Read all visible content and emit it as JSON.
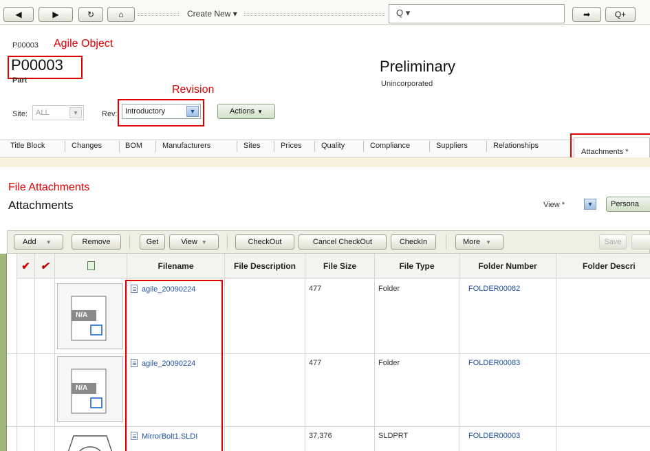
{
  "nav": {
    "create_new_label": "Create New",
    "create_new_caret": "▾",
    "search_glyph": "Q ▾",
    "add_search_glyph": "Q+"
  },
  "object": {
    "number_small": "P00003",
    "annotation_agile_object": "Agile Object",
    "number_big": "P00003",
    "type": "Part",
    "status": "Preliminary",
    "status_sub": "Unincorporated",
    "annotation_revision": "Revision"
  },
  "site": {
    "label": "Site:",
    "value": "ALL"
  },
  "rev": {
    "label": "Rev:",
    "value": "Introductory"
  },
  "actions_label": "Actions",
  "tabs": [
    "Title Block",
    "Changes",
    "BOM",
    "Manufacturers",
    "Sites",
    "Prices",
    "Quality",
    "Compliance",
    "Suppliers",
    "Relationships"
  ],
  "tab_active": "Attachments *",
  "section": {
    "annotation": "File Attachments",
    "title": "Attachments",
    "view_label": "View *",
    "personal_label": "Persona"
  },
  "toolbar": {
    "add": "Add",
    "remove": "Remove",
    "get": "Get",
    "view": "View",
    "checkout": "CheckOut",
    "cancel_checkout": "Cancel CheckOut",
    "checkin": "CheckIn",
    "more": "More",
    "save": "Save"
  },
  "columns": {
    "filename": "Filename",
    "file_description": "File Description",
    "file_size": "File Size",
    "file_type": "File Type",
    "folder_number": "Folder Number",
    "folder_description": "Folder Descri"
  },
  "rows": [
    {
      "filename": "agile_20090224",
      "file_description": "",
      "file_size": "477",
      "file_type": "Folder",
      "folder_number": "FOLDER00082",
      "thumb": "N/A"
    },
    {
      "filename": "agile_20090224",
      "file_description": "",
      "file_size": "477",
      "file_type": "Folder",
      "folder_number": "FOLDER00083",
      "thumb": "N/A"
    },
    {
      "filename": "MirrorBolt1.SLDI",
      "file_description": "",
      "file_size": "37,376",
      "file_type": "SLDPRT",
      "folder_number": "FOLDER00003",
      "thumb": ""
    }
  ],
  "colors": {
    "annotation_red": "#e00000",
    "link_blue": "#1e4f9c",
    "strip_green": "#9db87a"
  }
}
